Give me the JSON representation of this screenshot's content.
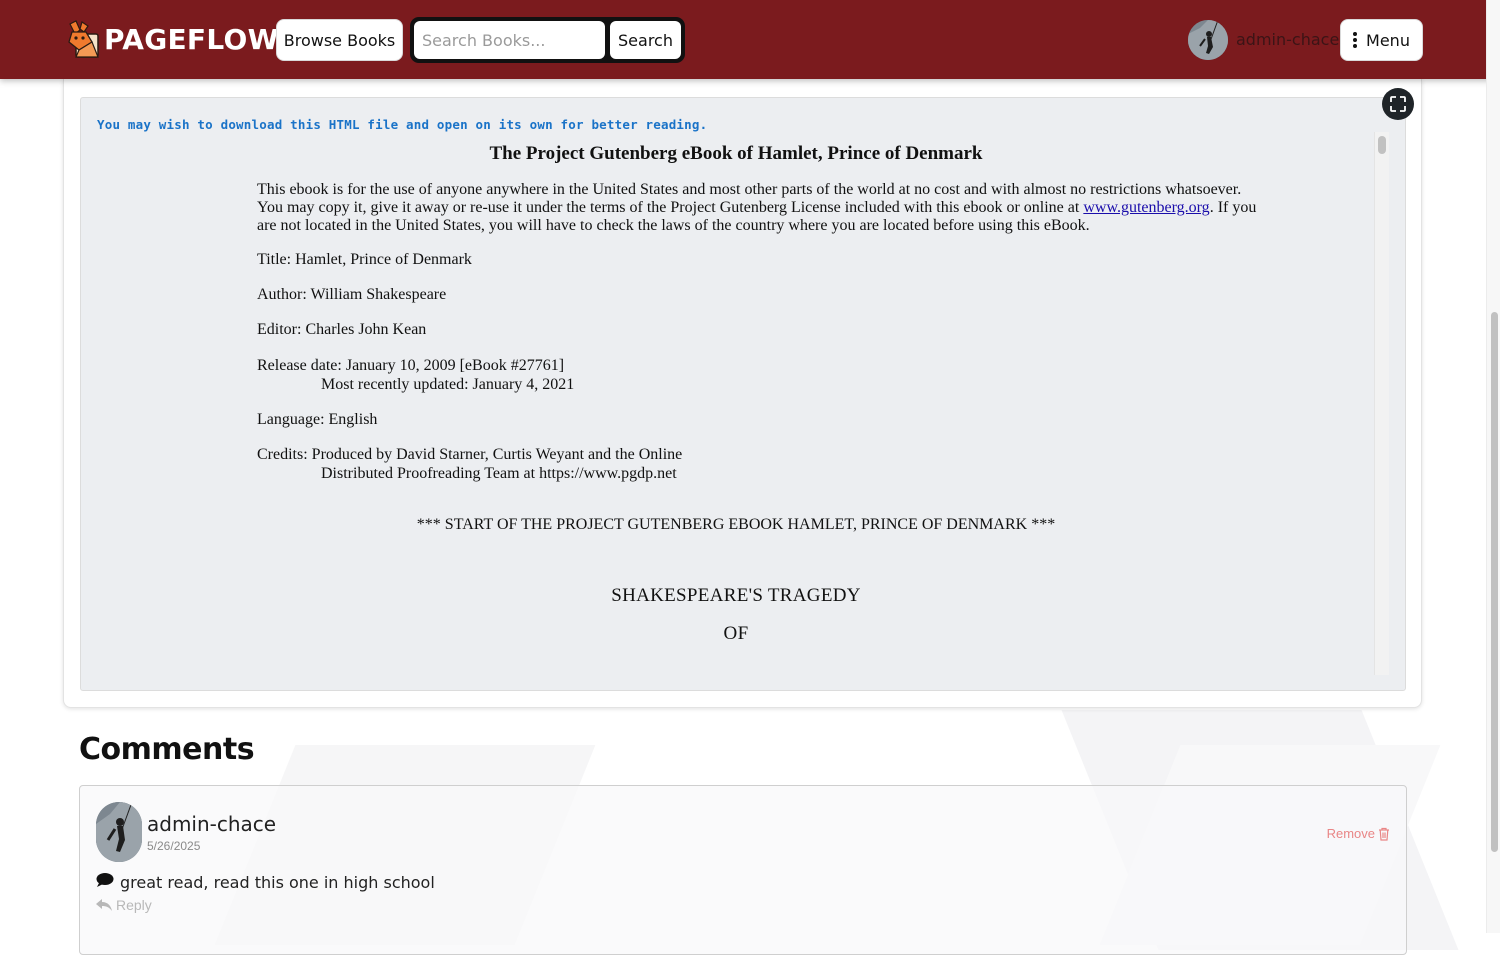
{
  "navbar": {
    "brand": "PAGEFLOW",
    "browse_label": "Browse Books",
    "search_placeholder": "Search Books...",
    "search_label": "Search",
    "username": "admin-chace",
    "menu_label": "Menu"
  },
  "reader": {
    "download_note": "You may wish to download this HTML file and open on its own for better reading.",
    "book_title": "The Project Gutenberg eBook of Hamlet, Prince of Denmark",
    "intro_part1": "This ebook is for the use of anyone anywhere in the United States and most other parts of the world at no cost and with almost no restrictions whatsoever. You may copy it, give it away or re-use it under the terms of the Project Gutenberg License included with this ebook or online at ",
    "intro_link": "www.gutenberg.org",
    "intro_part2": ". If you are not located in the United States, you will have to check the laws of the country where you are located before using this eBook.",
    "title_line": "Title: Hamlet, Prince of Denmark",
    "author_line": "Author: William Shakespeare",
    "editor_line": "Editor: Charles John Kean",
    "release_line": "Release date: January 10, 2009 [eBook #27761]",
    "updated_line": "Most recently updated: January 4, 2021",
    "language_line": "Language: English",
    "credits_line1": "Credits: Produced by David Starner, Curtis Weyant and the Online",
    "credits_line2": "Distributed Proofreading Team at https://www.pgdp.net",
    "start_line": "*** START OF THE PROJECT GUTENBERG EBOOK HAMLET, PRINCE OF DENMARK ***",
    "heading_tragedy": "SHAKESPEARE'S TRAGEDY",
    "heading_of": "OF"
  },
  "comments": {
    "heading": "Comments",
    "items": [
      {
        "author": "admin-chace",
        "date": "5/26/2025",
        "text": "great read, read this one in high school",
        "remove_label": "Remove",
        "reply_label": "Reply"
      }
    ]
  },
  "colors": {
    "navbar": "#7b1b1e",
    "link": "#1a73c8",
    "remove": "#e98686"
  }
}
